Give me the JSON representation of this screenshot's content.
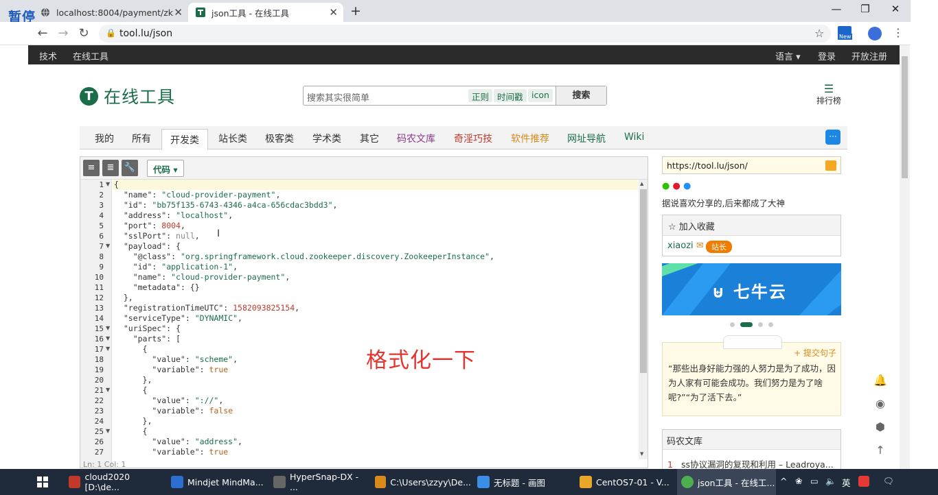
{
  "browser": {
    "overlay_label": "暂停",
    "tabs": [
      {
        "title": "localhost:8004/payment/zk",
        "active": false
      },
      {
        "title": "json工具 - 在线工具",
        "active": true
      }
    ],
    "url": "tool.lu/json",
    "new_badge": "New"
  },
  "site_bar": {
    "left": [
      "技术",
      "在线工具"
    ],
    "right": [
      "语言 ▾",
      "登录",
      "开放注册"
    ]
  },
  "header": {
    "logo_mark": "T",
    "logo_text": "在线工具",
    "search_placeholder": "搜索其实很简单",
    "chips": [
      "正则",
      "时间戳",
      "icon"
    ],
    "search_button": "搜索",
    "rank_label": "排行榜"
  },
  "categories": [
    {
      "label": "我的",
      "color": "#333333",
      "active": false
    },
    {
      "label": "所有",
      "color": "#333333",
      "active": false
    },
    {
      "label": "开发类",
      "color": "#333333",
      "active": true
    },
    {
      "label": "站长类",
      "color": "#333333",
      "active": false
    },
    {
      "label": "极客类",
      "color": "#333333",
      "active": false
    },
    {
      "label": "学术类",
      "color": "#333333",
      "active": false
    },
    {
      "label": "其它",
      "color": "#333333",
      "active": false
    },
    {
      "label": "码农文库",
      "color": "#8b3a8b",
      "active": false
    },
    {
      "label": "奇淫巧技",
      "color": "#c0392b",
      "active": false
    },
    {
      "label": "软件推荐",
      "color": "#d98a1c",
      "active": false
    },
    {
      "label": "网址导航",
      "color": "#1b6d4a",
      "active": false
    },
    {
      "label": "Wiki",
      "color": "#1b6d4a",
      "active": false
    }
  ],
  "editor": {
    "code_button": "代码 ▾",
    "status": "Ln: 1    Col: 1",
    "lines": [
      "{",
      "  \"name\": \"cloud-provider-payment\",",
      "  \"id\": \"bb75f135-6743-4346-a4ca-656cdac3bdd3\",",
      "  \"address\": \"localhost\",",
      "  \"port\": 8004,",
      "  \"sslPort\": null,",
      "  \"payload\": {",
      "    \"@class\": \"org.springframework.cloud.zookeeper.discovery.ZookeeperInstance\",",
      "    \"id\": \"application-1\",",
      "    \"name\": \"cloud-provider-payment\",",
      "    \"metadata\": {}",
      "  },",
      "  \"registrationTimeUTC\": 1582093825154,",
      "  \"serviceType\": \"DYNAMIC\",",
      "  \"uriSpec\": {",
      "    \"parts\": [",
      "      {",
      "        \"value\": \"scheme\",",
      "        \"variable\": true",
      "      },",
      "      {",
      "        \"value\": \"://\",",
      "        \"variable\": false",
      "      },",
      "      {",
      "        \"value\": \"address\",",
      "        \"variable\": true"
    ],
    "fold_lines": [
      1,
      7,
      15,
      16,
      17,
      21,
      25
    ]
  },
  "annotation": "格式化一下",
  "sidebar": {
    "url": "https://tool.lu/json/",
    "share_text": "据说喜欢分享的,后来都成了大神",
    "favorites_title": "加入收藏",
    "user": "xiaozi",
    "user_badge": "站长",
    "banner_text": "七牛云",
    "quote_submit": "+ 提交句子",
    "quote": "“那些出身好能力强的人努力是为了成功，因为人家有可能会成功。我们努力是为了啥呢?”“为了活下去。”",
    "wenku_title": "码农文库",
    "wenku_item_num": "1",
    "wenku_item": "ss协议漏洞的复现和利用 – Leadroya..."
  },
  "taskbar": {
    "items": [
      {
        "label": "cloud2020 [D:\\de...",
        "color": "#c0392b"
      },
      {
        "label": "Mindjet MindMa...",
        "color": "#2c6fd1"
      },
      {
        "label": "HyperSnap-DX - ...",
        "color": "#666666"
      },
      {
        "label": "C:\\Users\\zzyy\\De...",
        "color": "#d98a1c"
      },
      {
        "label": "无标题 - 画图",
        "color": "#3a8ee6"
      },
      {
        "label": "CentOS7-01 - V...",
        "color": "#e8a72b"
      },
      {
        "label": "json工具 - 在线工...",
        "color": "#4caf50"
      }
    ],
    "ime": "英"
  }
}
